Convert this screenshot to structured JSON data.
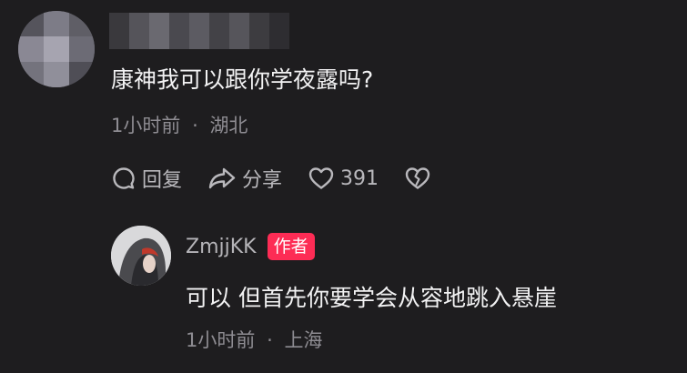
{
  "comment": {
    "text": "康神我可以跟你学夜露吗?",
    "time": "1小时前",
    "separator": "·",
    "location": "湖北",
    "actions": {
      "reply_label": "回复",
      "share_label": "分享",
      "like_count": "391"
    }
  },
  "reply": {
    "username": "ZmjjKK",
    "author_badge": "作者",
    "text": "可以 但首先你要学会从容地跳入悬崖",
    "time": "1小时前",
    "separator": "·",
    "location": "上海"
  },
  "colors": {
    "background": "#1e1d1f",
    "author_badge": "#fd2c55",
    "secondary_text": "#8e8c92"
  }
}
